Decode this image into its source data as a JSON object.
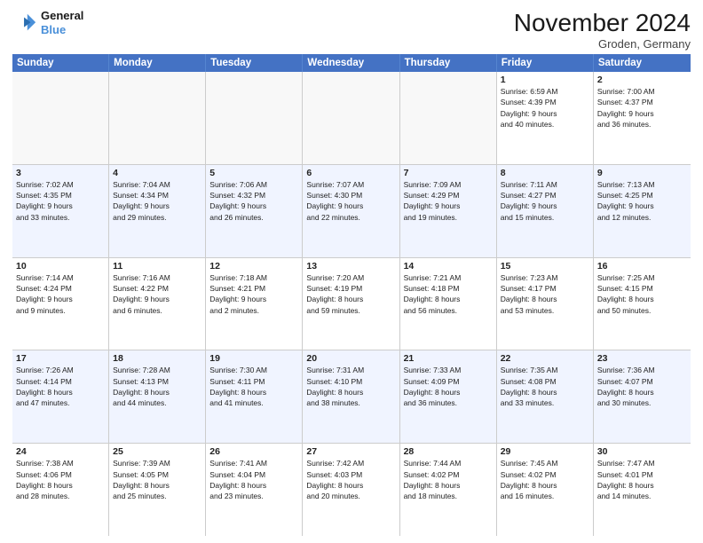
{
  "logo": {
    "line1": "General",
    "line2": "Blue"
  },
  "title": "November 2024",
  "location": "Groden, Germany",
  "days_of_week": [
    "Sunday",
    "Monday",
    "Tuesday",
    "Wednesday",
    "Thursday",
    "Friday",
    "Saturday"
  ],
  "weeks": [
    [
      {
        "day": "",
        "info": ""
      },
      {
        "day": "",
        "info": ""
      },
      {
        "day": "",
        "info": ""
      },
      {
        "day": "",
        "info": ""
      },
      {
        "day": "",
        "info": ""
      },
      {
        "day": "1",
        "info": "Sunrise: 6:59 AM\nSunset: 4:39 PM\nDaylight: 9 hours\nand 40 minutes."
      },
      {
        "day": "2",
        "info": "Sunrise: 7:00 AM\nSunset: 4:37 PM\nDaylight: 9 hours\nand 36 minutes."
      }
    ],
    [
      {
        "day": "3",
        "info": "Sunrise: 7:02 AM\nSunset: 4:35 PM\nDaylight: 9 hours\nand 33 minutes."
      },
      {
        "day": "4",
        "info": "Sunrise: 7:04 AM\nSunset: 4:34 PM\nDaylight: 9 hours\nand 29 minutes."
      },
      {
        "day": "5",
        "info": "Sunrise: 7:06 AM\nSunset: 4:32 PM\nDaylight: 9 hours\nand 26 minutes."
      },
      {
        "day": "6",
        "info": "Sunrise: 7:07 AM\nSunset: 4:30 PM\nDaylight: 9 hours\nand 22 minutes."
      },
      {
        "day": "7",
        "info": "Sunrise: 7:09 AM\nSunset: 4:29 PM\nDaylight: 9 hours\nand 19 minutes."
      },
      {
        "day": "8",
        "info": "Sunrise: 7:11 AM\nSunset: 4:27 PM\nDaylight: 9 hours\nand 15 minutes."
      },
      {
        "day": "9",
        "info": "Sunrise: 7:13 AM\nSunset: 4:25 PM\nDaylight: 9 hours\nand 12 minutes."
      }
    ],
    [
      {
        "day": "10",
        "info": "Sunrise: 7:14 AM\nSunset: 4:24 PM\nDaylight: 9 hours\nand 9 minutes."
      },
      {
        "day": "11",
        "info": "Sunrise: 7:16 AM\nSunset: 4:22 PM\nDaylight: 9 hours\nand 6 minutes."
      },
      {
        "day": "12",
        "info": "Sunrise: 7:18 AM\nSunset: 4:21 PM\nDaylight: 9 hours\nand 2 minutes."
      },
      {
        "day": "13",
        "info": "Sunrise: 7:20 AM\nSunset: 4:19 PM\nDaylight: 8 hours\nand 59 minutes."
      },
      {
        "day": "14",
        "info": "Sunrise: 7:21 AM\nSunset: 4:18 PM\nDaylight: 8 hours\nand 56 minutes."
      },
      {
        "day": "15",
        "info": "Sunrise: 7:23 AM\nSunset: 4:17 PM\nDaylight: 8 hours\nand 53 minutes."
      },
      {
        "day": "16",
        "info": "Sunrise: 7:25 AM\nSunset: 4:15 PM\nDaylight: 8 hours\nand 50 minutes."
      }
    ],
    [
      {
        "day": "17",
        "info": "Sunrise: 7:26 AM\nSunset: 4:14 PM\nDaylight: 8 hours\nand 47 minutes."
      },
      {
        "day": "18",
        "info": "Sunrise: 7:28 AM\nSunset: 4:13 PM\nDaylight: 8 hours\nand 44 minutes."
      },
      {
        "day": "19",
        "info": "Sunrise: 7:30 AM\nSunset: 4:11 PM\nDaylight: 8 hours\nand 41 minutes."
      },
      {
        "day": "20",
        "info": "Sunrise: 7:31 AM\nSunset: 4:10 PM\nDaylight: 8 hours\nand 38 minutes."
      },
      {
        "day": "21",
        "info": "Sunrise: 7:33 AM\nSunset: 4:09 PM\nDaylight: 8 hours\nand 36 minutes."
      },
      {
        "day": "22",
        "info": "Sunrise: 7:35 AM\nSunset: 4:08 PM\nDaylight: 8 hours\nand 33 minutes."
      },
      {
        "day": "23",
        "info": "Sunrise: 7:36 AM\nSunset: 4:07 PM\nDaylight: 8 hours\nand 30 minutes."
      }
    ],
    [
      {
        "day": "24",
        "info": "Sunrise: 7:38 AM\nSunset: 4:06 PM\nDaylight: 8 hours\nand 28 minutes."
      },
      {
        "day": "25",
        "info": "Sunrise: 7:39 AM\nSunset: 4:05 PM\nDaylight: 8 hours\nand 25 minutes."
      },
      {
        "day": "26",
        "info": "Sunrise: 7:41 AM\nSunset: 4:04 PM\nDaylight: 8 hours\nand 23 minutes."
      },
      {
        "day": "27",
        "info": "Sunrise: 7:42 AM\nSunset: 4:03 PM\nDaylight: 8 hours\nand 20 minutes."
      },
      {
        "day": "28",
        "info": "Sunrise: 7:44 AM\nSunset: 4:02 PM\nDaylight: 8 hours\nand 18 minutes."
      },
      {
        "day": "29",
        "info": "Sunrise: 7:45 AM\nSunset: 4:02 PM\nDaylight: 8 hours\nand 16 minutes."
      },
      {
        "day": "30",
        "info": "Sunrise: 7:47 AM\nSunset: 4:01 PM\nDaylight: 8 hours\nand 14 minutes."
      }
    ]
  ]
}
